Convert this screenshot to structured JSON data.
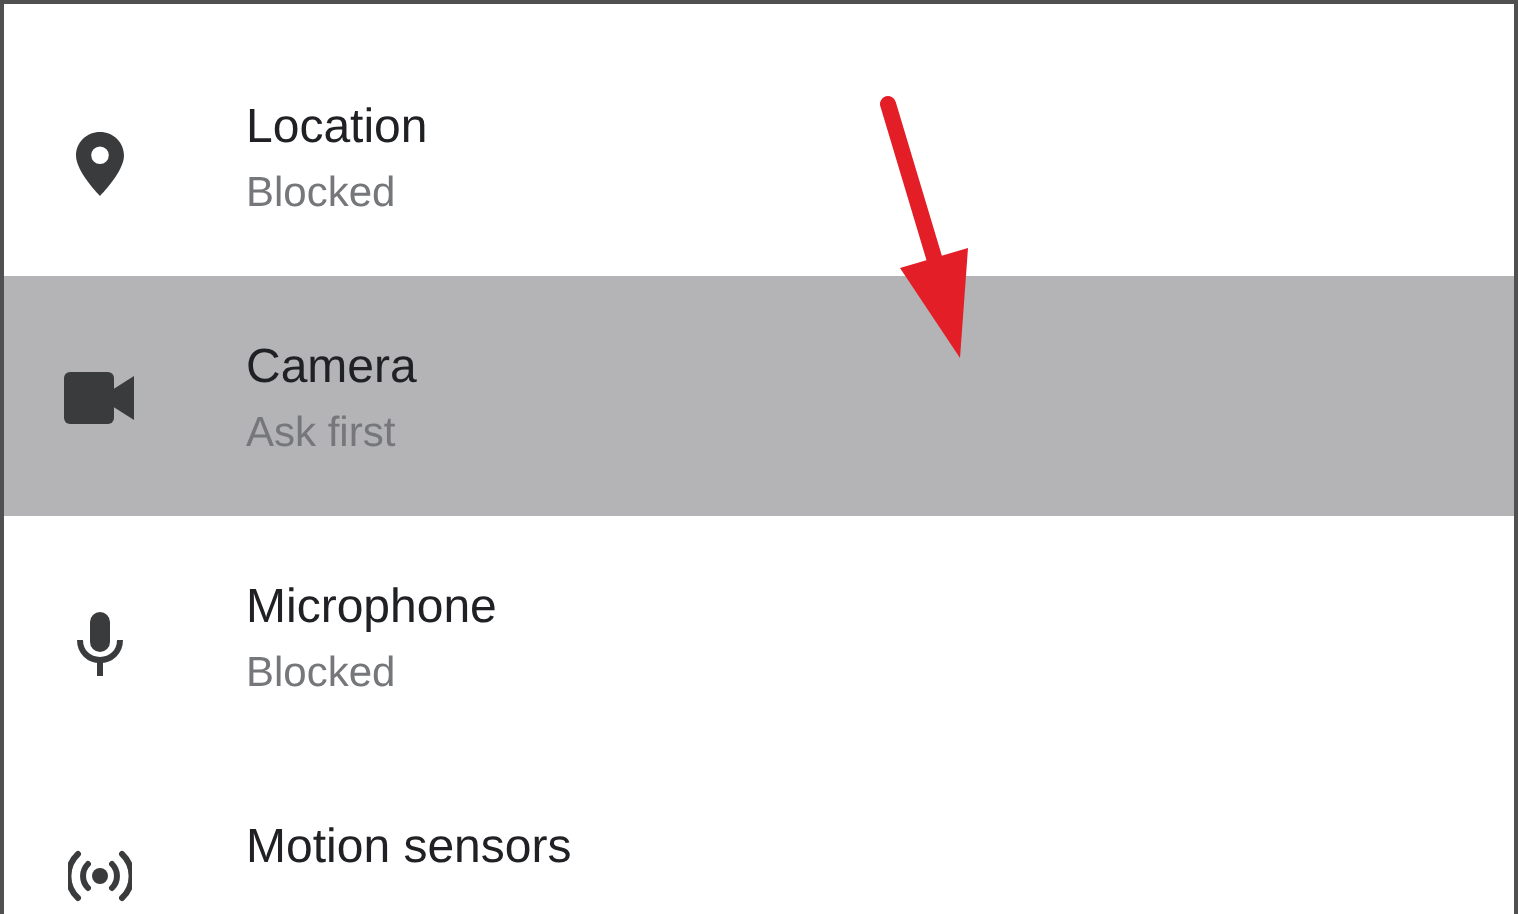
{
  "permissions": [
    {
      "title": "Location",
      "status": "Blocked",
      "selected": false
    },
    {
      "title": "Camera",
      "status": "Ask first",
      "selected": true
    },
    {
      "title": "Microphone",
      "status": "Blocked",
      "selected": false
    },
    {
      "title": "Motion sensors",
      "selected": false
    }
  ]
}
